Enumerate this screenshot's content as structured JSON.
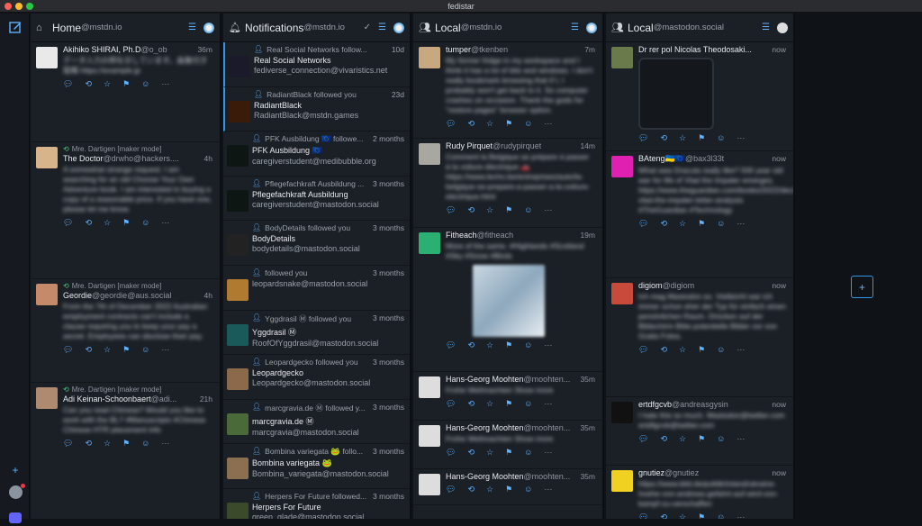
{
  "window_title": "fedistar",
  "columns": {
    "home": {
      "title": "Home",
      "account": "@mstdn.io"
    },
    "notifications": {
      "title": "Notifications",
      "account": "@mstdn.io"
    },
    "local1": {
      "title": "Local",
      "account": "@mstdn.io"
    },
    "local2": {
      "title": "Local",
      "account": "@mastodon.social"
    }
  },
  "home_items": [
    {
      "boost": "",
      "name": "Akihiko SHIRAI, Ph.D",
      "acct": "@o_ob",
      "time": "36m",
      "body": "データ入力の例を示しています。画像付き投稿 https://example.jp",
      "color": "#e9e9e9"
    },
    {
      "boost": "Mre. Dartigen [maker mode]",
      "name": "The Doctor",
      "acct": "@drwho@hackers....",
      "time": "4h",
      "body": "A somewhat strange request. I am searching for an old Choose Your Own Adventure book. I am interested in buying a copy of a reasonable price. If you have one, please let me know.",
      "color": "#d8b48a"
    },
    {
      "boost": "Mre. Dartigen [maker mode]",
      "name": "Geordie",
      "acct": "@geordie@aus.social",
      "time": "4h",
      "body": "From the 7th of December 2022 Australian employment contracts can't include a clause requiring you to keep your pay a secret. Employees can disclose their pay.",
      "color": "#c48a6a"
    },
    {
      "boost": "Mre. Dartigen [maker mode]",
      "name": "Adi Keinan-Schoonbaert",
      "acct": "@adi...",
      "time": "21h",
      "body": "Can you read Chinese? Would you like to work with the BL? #Manuscripts #Chinese Chinese HTR placement info",
      "color": "#b08a70"
    }
  ],
  "notif_items": [
    {
      "text": "Real Social Networks follow...",
      "name": "Real Social Networks",
      "handle": "fediverse_connection@vivaristics.net",
      "time": "10d",
      "color": "#1a1a2a"
    },
    {
      "text": "RadiantBlack followed you",
      "name": "RadiantBlack",
      "handle": "RadiantBlack@mstdn.games",
      "time": "23d",
      "color": "#3a1a08"
    },
    {
      "text": "PFK Ausbildung 🇪🇺 followe...",
      "name": "PFK Ausbildung 🇪🇺",
      "handle": "caregiverstudent@medibubble.org",
      "time": "2 months",
      "color": "#0d1612"
    },
    {
      "text": "Pflegefachkraft Ausbildung ...",
      "name": "Pflegefachkraft Ausbildung",
      "handle": "caregiverstudent@mastodon.social",
      "time": "3 months",
      "color": "#0d1612"
    },
    {
      "text": "BodyDetails followed you",
      "name": "BodyDetails",
      "handle": "bodydetails@mastodon.social",
      "time": "3 months",
      "color": "#222"
    },
    {
      "text": "followed you",
      "name": "",
      "handle": "leopardsnake@mastodon.social",
      "time": "3 months",
      "color": "#b07a30"
    },
    {
      "text": "Yggdrasil Ⓜ followed you",
      "name": "Yggdrasil Ⓜ",
      "handle": "RoofOfYggdrasil@mastodon.social",
      "time": "3 months",
      "color": "#1a5a5a"
    },
    {
      "text": "Leopardgecko followed you",
      "name": "Leopardgecko",
      "handle": "Leopardgecko@mastodon.social",
      "time": "3 months",
      "color": "#8a6a4a"
    },
    {
      "text": "marcgravia.de Ⓜ followed y...",
      "name": "marcgravia.de Ⓜ",
      "handle": "marcgravia@mastodon.social",
      "time": "3 months",
      "color": "#4a6a3a"
    },
    {
      "text": "Bombina variegata 🐸 follo...",
      "name": "Bombina variegata 🐸",
      "handle": "Bombina_variegata@mastodon.social",
      "time": "3 months",
      "color": "#8a7050"
    },
    {
      "text": "Herpers For Future followed...",
      "name": "Herpers For Future",
      "handle": "green_glade@mastodon.social",
      "time": "3 months",
      "color": "#3a4a2a"
    }
  ],
  "local1_items": [
    {
      "name": "tumper",
      "acct": "@tkenben",
      "time": "7m",
      "body": "My former fridge in my workspace and I think it has a lot of bits and windows. I don't really bookmark browsing that if I, I probably won't get back to it. So computer crashes on occasion. Thank the gods for \"restore pages\" browser option.",
      "color": "#c8a880"
    },
    {
      "name": "Rudy Pirquet",
      "acct": "@rudypirquet",
      "time": "14m",
      "body": "Comment la Belgique se prépare à passer à la voiture électrique 🚗 https://www.lecho.be/entreprises/auto/la-belgique-se-prepare-a-passer-a-la-voiture-electrique.html",
      "color": "#a8a8a0"
    },
    {
      "name": "Fitheach",
      "acct": "@fitheach",
      "time": "19m",
      "body": "More of the same. #Highlands #Scotland #Sky #Snow #Birds",
      "color": "#2ab070",
      "media": true
    },
    {
      "name": "Hans-Georg Moohten",
      "acct": "@moohten...",
      "time": "35m",
      "body": "Frohe Weihnachten Show more",
      "color": "#ddd"
    },
    {
      "name": "Hans-Georg Moohten",
      "acct": "@moohten...",
      "time": "35m",
      "body": "Frohe Weihnachten Show more",
      "color": "#ddd"
    },
    {
      "name": "Hans-Georg Moohten",
      "acct": "@moohten...",
      "time": "35m",
      "body": "",
      "color": "#ddd"
    }
  ],
  "local2_items": [
    {
      "name": "Dr rer pol Nicolas Theodosaki...",
      "acct": "",
      "time": "now",
      "body": "",
      "color": "#6a7a4a",
      "card": true
    },
    {
      "name": "BAteng🇺🇦🇪🇺",
      "acct": "@bax3l33t",
      "time": "now",
      "body": "What was Dracula really like? 500 year old war for life of Vlad the Impaler emerges. https://www.theguardian.com/books/2022/dec/29/dracula-vlad-the-impaler-letter-analysis #TheGuardian #Technology",
      "color": "#e020b0"
    },
    {
      "name": "digiom",
      "acct": "@digiom",
      "time": "now",
      "body": "Ich mag Mastodon so. Vielleicht war ich immer schon eher der Typ für einfach einen persönlichen Raum. Drücken auf der Bildschirm Bitte potentielle Bilder vor von Gratis Fotos.",
      "color": "#c84a3a"
    },
    {
      "name": "ertdfgcvb",
      "acct": "@andreasgysin",
      "time": "now",
      "body": "I hate this so much. Mastodon@twitter.com ertdfgcvb@twitter.com",
      "color": "#111"
    },
    {
      "name": "gnutiez",
      "acct": "@gnutiez",
      "time": "now",
      "body": "https://www.bild.de/politik/inland/ukraine-hoehe-von-andreas-gefahrt-auf-wird-von-kampf-zu-verschaffen",
      "color": "#f0d020"
    }
  ],
  "colors": {
    "accent": "#2f9be8",
    "bg": "#0f1217",
    "column": "#1b1f26"
  },
  "icons": {
    "compose": "pencil-square-icon",
    "home": "house-icon",
    "notifications": "bell-icon",
    "local": "people-icon",
    "settings": "sliders-icon",
    "add": "plus-icon"
  }
}
